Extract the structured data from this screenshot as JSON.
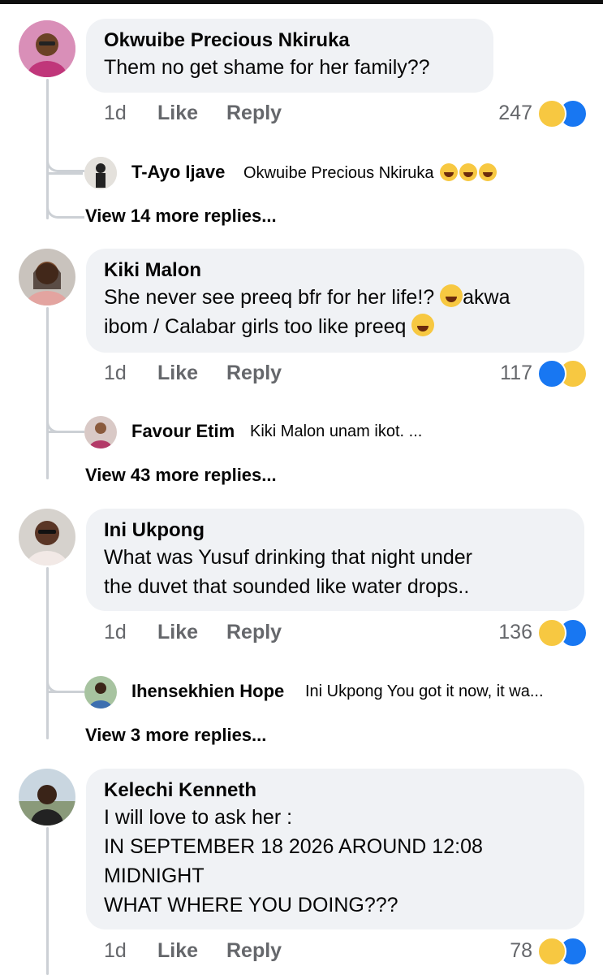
{
  "comments": [
    {
      "name": "Okwuibe Precious Nkiruka",
      "text": "Them no get shame for her family??",
      "time": "1d",
      "like": "Like",
      "reply": "Reply",
      "count": "247",
      "reactions": [
        "haha-icon",
        "like-icon"
      ],
      "reply_preview": {
        "name": "T-Ayo Ijave",
        "text": "Okwuibe Precious Nkiruka"
      },
      "more": "View 14 more replies..."
    },
    {
      "name": "Kiki Malon",
      "text_line1": "She never see preeq bfr for her life!?",
      "text_line1_tail": "akwa",
      "text_line2": "ibom / Calabar girls too like preeq",
      "time": "1d",
      "like": "Like",
      "reply": "Reply",
      "count": "117",
      "reactions": [
        "like-icon",
        "haha-icon"
      ],
      "reply_preview": {
        "name": "Favour Etim",
        "text": "Kiki Malon unam ikot. ..."
      },
      "more": "View 43 more replies..."
    },
    {
      "name": "Ini Ukpong",
      "text_line1": "What was Yusuf drinking that night under",
      "text_line2": "the duvet that sounded like water drops..",
      "time": "1d",
      "like": "Like",
      "reply": "Reply",
      "count": "136",
      "reactions": [
        "haha-icon",
        "like-icon"
      ],
      "reply_preview": {
        "name": "Ihensekhien Hope",
        "text": "Ini Ukpong You got it now, it wa..."
      },
      "more": "View 3 more replies..."
    },
    {
      "name": "Kelechi Kenneth",
      "lines": [
        "I will love to ask her :",
        "IN SEPTEMBER 18 2026 AROUND 12:08",
        "MIDNIGHT",
        "WHAT WHERE YOU DOING???"
      ],
      "time": "1d",
      "like": "Like",
      "reply": "Reply",
      "count": "78",
      "reactions": [
        "haha-icon",
        "like-icon"
      ]
    }
  ],
  "colors": {
    "bubble": "#f0f2f5",
    "like_blue": "#1877f2",
    "haha_yellow": "#f7c841",
    "meta_gray": "#65676b"
  }
}
